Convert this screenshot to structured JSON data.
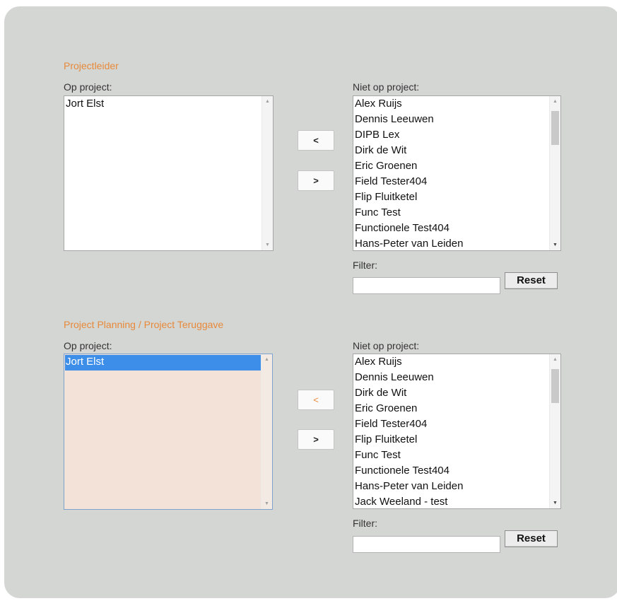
{
  "sections": [
    {
      "title": "Projectleider",
      "on_label": "Op project:",
      "on_items": [
        "Jort Elst"
      ],
      "off_label": "Niet op project:",
      "off_items": [
        "Alex Ruijs",
        "Dennis Leeuwen",
        "DIPB Lex",
        "Dirk de Wit",
        "Eric Groenen",
        "Field Tester404",
        "Flip Fluitketel",
        "Func Test",
        "Functionele Test404",
        "Hans-Peter van Leiden"
      ],
      "add_label": "<",
      "remove_label": ">",
      "filter_label": "Filter:",
      "filter_value": "",
      "reset_label": "Reset"
    },
    {
      "title": "Project Planning / Project Teruggave",
      "on_label": "Op project:",
      "on_items": [
        "Jort Elst"
      ],
      "off_label": "Niet op project:",
      "off_items": [
        "Alex Ruijs",
        "Dennis Leeuwen",
        "Dirk de Wit",
        "Eric Groenen",
        "Field Tester404",
        "Flip Fluitketel",
        "Func Test",
        "Functionele Test404",
        "Hans-Peter van Leiden",
        "Jack Weeland - test"
      ],
      "add_label": "<",
      "remove_label": ">",
      "filter_label": "Filter:",
      "filter_value": "",
      "reset_label": "Reset"
    }
  ]
}
